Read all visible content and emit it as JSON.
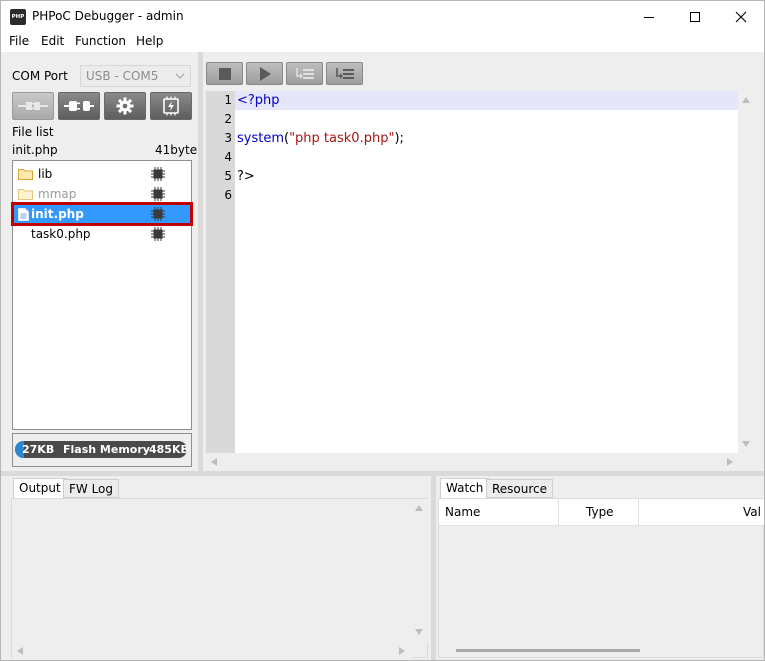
{
  "window": {
    "title": "PHPoC Debugger - admin",
    "icon_text": "PHP"
  },
  "menu": [
    "File",
    "Edit",
    "Function",
    "Help"
  ],
  "left": {
    "com_port_label": "COM Port",
    "com_port_value": "USB - COM5",
    "file_list_label": "File list",
    "selected_file": "init.php",
    "selected_size": "41byte",
    "tree": [
      {
        "name": "lib",
        "type": "folder",
        "disabled": false,
        "selected": false
      },
      {
        "name": "mmap",
        "type": "folder",
        "disabled": true,
        "selected": false
      },
      {
        "name": "init.php",
        "type": "file",
        "disabled": false,
        "selected": true
      },
      {
        "name": "task0.php",
        "type": "file",
        "disabled": false,
        "selected": false
      }
    ],
    "flash": {
      "used": "27KB",
      "label": "Flash Memory",
      "free": "485KB",
      "used_fraction": 0.053
    }
  },
  "editor": {
    "line_numbers": [
      "1",
      "2",
      "3",
      "4",
      "5",
      "6"
    ],
    "lines": [
      {
        "parts": [
          {
            "t": "<?php",
            "c": "#0000c0"
          }
        ]
      },
      {
        "parts": []
      },
      {
        "parts": [
          {
            "t": "system",
            "c": "#0000c0"
          },
          {
            "t": "(",
            "c": "#000000"
          },
          {
            "t": "\"php task0.php\"",
            "c": "#a31515"
          },
          {
            "t": ");",
            "c": "#000000"
          }
        ]
      },
      {
        "parts": []
      },
      {
        "parts": [
          {
            "t": "?>",
            "c": "#000000"
          }
        ]
      },
      {
        "parts": []
      }
    ]
  },
  "bottom": {
    "output_tabs": [
      "Output",
      "FW Log"
    ],
    "watch_tabs": [
      "Watch",
      "Resource"
    ],
    "watch_columns": [
      "Name",
      "Type",
      "Val"
    ]
  },
  "colors": {
    "selection": "#3399ff",
    "highlight_border": "#c00000",
    "keyword": "#0000c0",
    "string": "#a31515"
  }
}
